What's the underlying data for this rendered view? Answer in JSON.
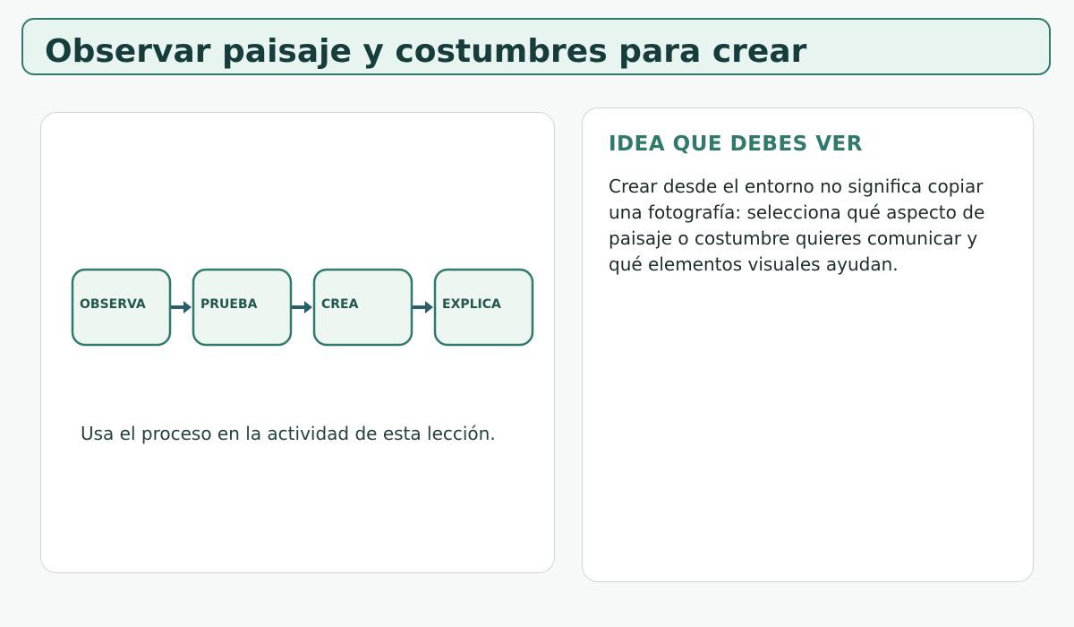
{
  "header": {
    "title": "Observar paisaje y costumbres para crear"
  },
  "process": {
    "steps": [
      {
        "label": "OBSERVA"
      },
      {
        "label": "PRUEBA"
      },
      {
        "label": "CREA"
      },
      {
        "label": "EXPLICA"
      }
    ],
    "caption": "Usa el proceso en la actividad de esta lección."
  },
  "idea": {
    "heading": "IDEA QUE DEBES VER",
    "body": "Crear desde el entorno no significa copiar una fotografía: selecciona qué aspecto de paisaje o costumbre quieres comunicar y qué elementos visuales ayudan."
  },
  "colors": {
    "accent": "#2f7a6c",
    "step_fill": "#eef6f2",
    "arrow": "#2a5f6a",
    "title_text": "#173c3c"
  }
}
